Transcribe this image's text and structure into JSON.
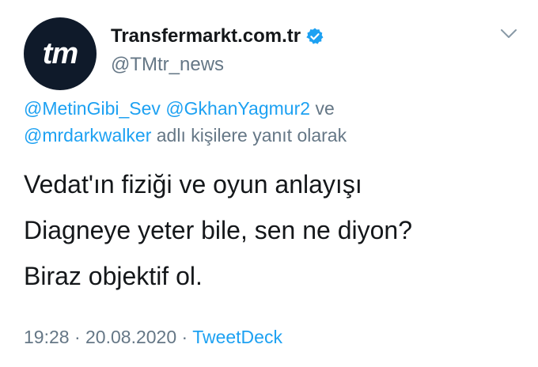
{
  "tweet": {
    "avatar_text": "tm",
    "display_name": "Transfermarkt.com.tr",
    "handle": "@TMtr_news",
    "reply": {
      "mention1": "@MetinGibi_Sev",
      "mention2": "@GkhanYagmur2",
      "conjunction": "ve",
      "mention3": "@mrdarkwalker",
      "suffix": "adlı kişilere yanıt olarak"
    },
    "body_lines": [
      "Vedat'ın fiziği ve oyun anlayışı",
      "Diagneye yeter bile, sen ne diyon?",
      "Biraz objektif ol."
    ],
    "time": "19:28",
    "separator": "·",
    "date": "20.08.2020",
    "source": "TweetDeck",
    "icons": {
      "verified": "verified-badge-icon",
      "more": "chevron-down-icon"
    },
    "colors": {
      "link": "#1da1f2",
      "secondary": "#657786",
      "avatar_bg": "#0f1a2a"
    }
  }
}
